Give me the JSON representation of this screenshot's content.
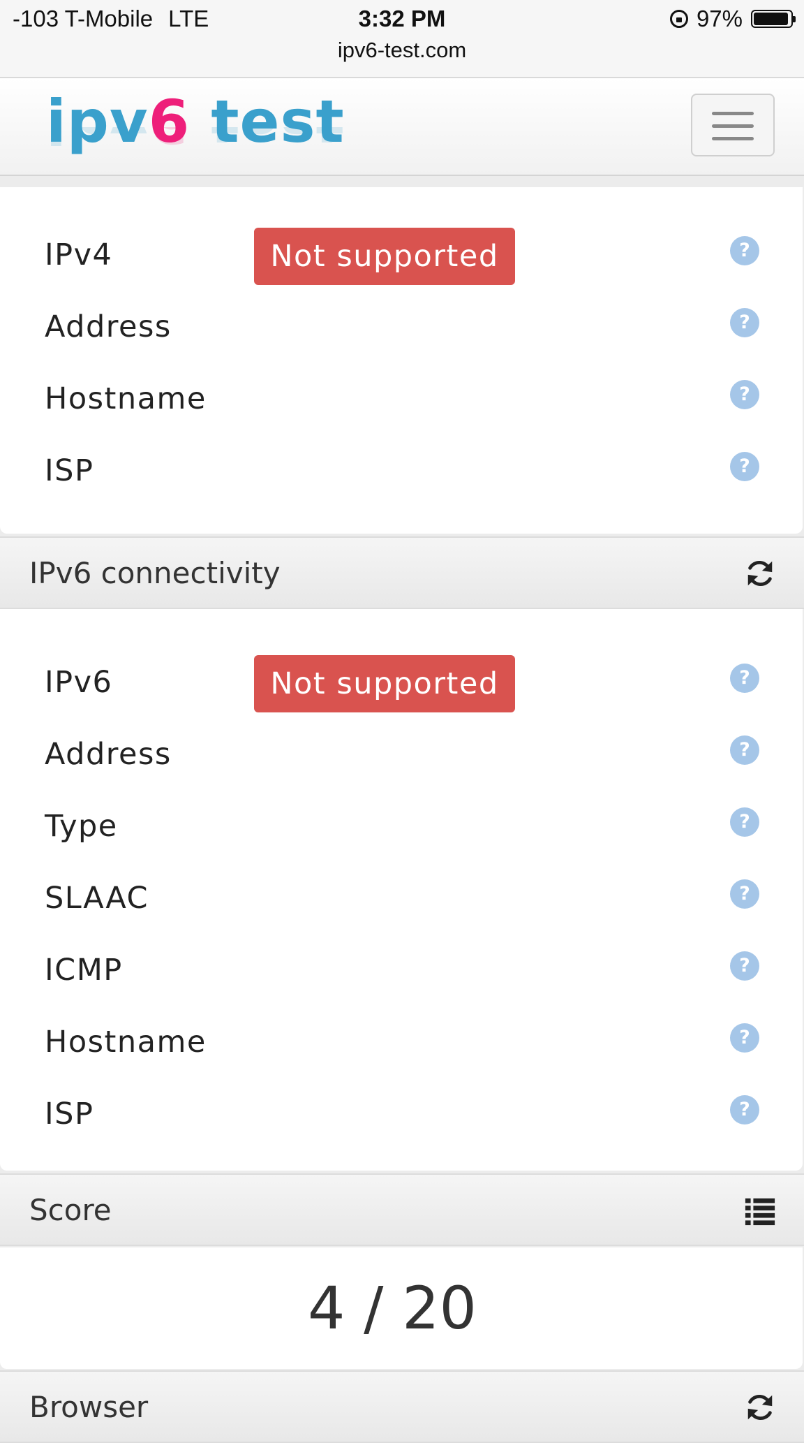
{
  "status_bar": {
    "carrier": "-103 T-Mobile",
    "network": "LTE",
    "time": "3:32 PM",
    "battery": "97%",
    "url": "ipv6-test.com"
  },
  "navbar": {
    "logo_part1": "ipv",
    "logo_part2": "6",
    "logo_part3": " test"
  },
  "ipv4_section": {
    "rows": [
      {
        "label": "IPv4",
        "badge": "Not supported"
      },
      {
        "label": "Address"
      },
      {
        "label": "Hostname"
      },
      {
        "label": "ISP"
      }
    ]
  },
  "ipv6_section": {
    "title": "IPv6 connectivity",
    "rows": [
      {
        "label": "IPv6",
        "badge": "Not supported"
      },
      {
        "label": "Address"
      },
      {
        "label": "Type"
      },
      {
        "label": "SLAAC"
      },
      {
        "label": "ICMP"
      },
      {
        "label": "Hostname"
      },
      {
        "label": "ISP"
      }
    ]
  },
  "score_section": {
    "title": "Score",
    "value": "4 / 20"
  },
  "browser_section": {
    "title": "Browser"
  },
  "icons": {
    "help": "question-circle-icon",
    "refresh": "refresh-icon",
    "list": "list-icon",
    "menu": "hamburger-icon"
  },
  "colors": {
    "badge_danger": "#d9534f",
    "help_icon": "#a5c6e8",
    "logo_blue": "#3aa0cc",
    "logo_pink": "#ee1f7a"
  }
}
